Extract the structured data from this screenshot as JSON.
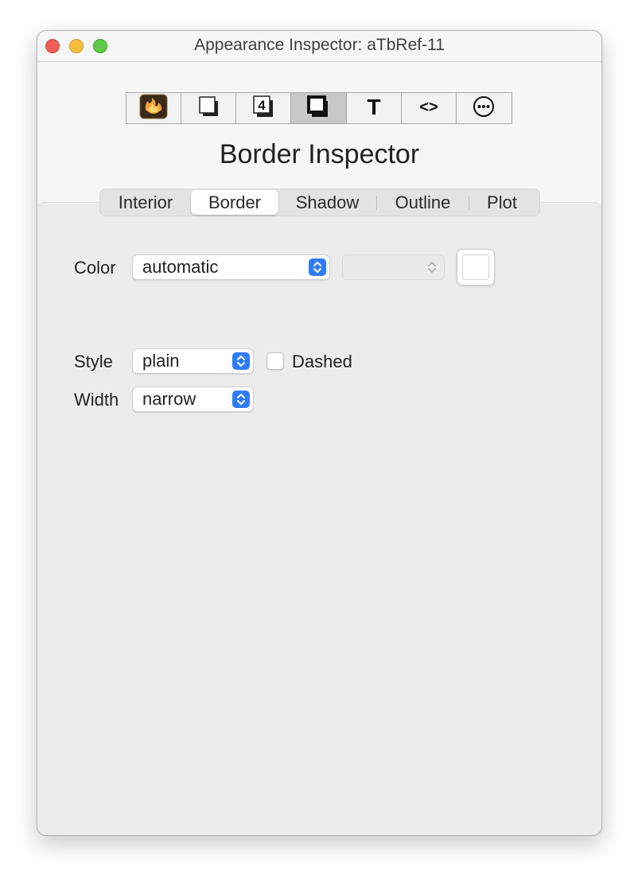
{
  "window": {
    "title": "Appearance Inspector: aTbRef-11"
  },
  "toolbar": {
    "items": [
      {
        "icon": "flame-icon"
      },
      {
        "icon": "note-shadow-icon"
      },
      {
        "icon": "number-badge-icon",
        "glyph": "4"
      },
      {
        "icon": "border-icon"
      },
      {
        "icon": "text-icon",
        "glyph": "T"
      },
      {
        "icon": "code-icon",
        "glyph": "<>"
      },
      {
        "icon": "more-icon"
      }
    ],
    "selected_index": 3
  },
  "heading": "Border Inspector",
  "tabs": {
    "items": [
      "Interior",
      "Border",
      "Shadow",
      "Outline",
      "Plot"
    ],
    "selected": "Border"
  },
  "form": {
    "color_label": "Color",
    "color_value": "automatic",
    "color_secondary_value": "",
    "swatch_color": "#ffffff",
    "style_label": "Style",
    "style_value": "plain",
    "dashed_label": "Dashed",
    "dashed_checked": false,
    "width_label": "Width",
    "width_value": "narrow"
  },
  "colors": {
    "accent": "#2f7cf6",
    "close": "#ee5e57",
    "minimize": "#f5bd40",
    "zoom": "#5fc74a"
  }
}
